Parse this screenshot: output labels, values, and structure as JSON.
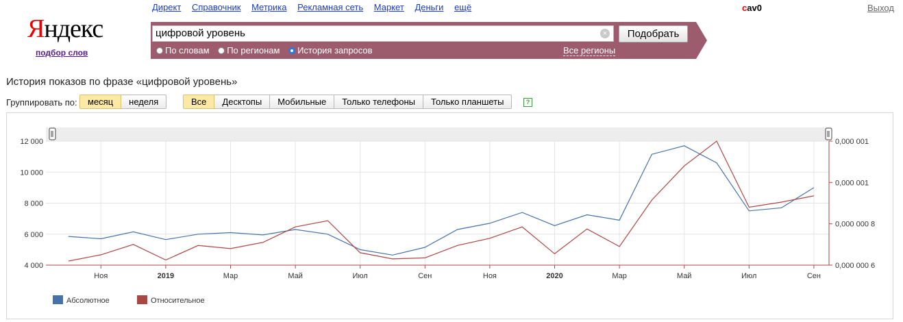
{
  "nav": {
    "links": [
      "Директ",
      "Справочник",
      "Метрика",
      "Рекламная сеть",
      "Маркет",
      "Деньги",
      "ещё"
    ],
    "user_first": "c",
    "user_rest": "av0",
    "logout": "Выход"
  },
  "logo": {
    "first": "Я",
    "rest": "ндекс",
    "sub": "подбор слов"
  },
  "search": {
    "query": "цифровой уровень",
    "clear_icon": "×",
    "submit_label": "Подобрать",
    "modes": [
      {
        "label": "По словам",
        "selected": false
      },
      {
        "label": "По регионам",
        "selected": false
      },
      {
        "label": "История запросов",
        "selected": true
      }
    ],
    "regions_link": "Все регионы"
  },
  "page": {
    "heading": "История показов по фразе «цифровой уровень»",
    "group_label": "Группировать по:",
    "period_buttons": [
      {
        "label": "месяц",
        "active": true
      },
      {
        "label": "неделя",
        "active": false
      }
    ],
    "device_buttons": [
      {
        "label": "Все",
        "active": true
      },
      {
        "label": "Десктопы",
        "active": false
      },
      {
        "label": "Мобильные",
        "active": false
      },
      {
        "label": "Только телефоны",
        "active": false
      },
      {
        "label": "Только планшеты",
        "active": false
      }
    ],
    "help_label": "?"
  },
  "chart_data": {
    "type": "line",
    "x": [
      "2018-10",
      "2018-11",
      "2018-12",
      "2019-01",
      "2019-02",
      "2019-03",
      "2019-04",
      "2019-05",
      "2019-06",
      "2019-07",
      "2019-08",
      "2019-09",
      "2019-10",
      "2019-11",
      "2019-12",
      "2020-01",
      "2020-02",
      "2020-03",
      "2020-04",
      "2020-05",
      "2020-06",
      "2020-07",
      "2020-08",
      "2020-09"
    ],
    "tick_labels": [
      {
        "month": "2018-11",
        "label": "Ноя",
        "bold": false
      },
      {
        "month": "2019-01",
        "label": "2019",
        "bold": true
      },
      {
        "month": "2019-03",
        "label": "Мар",
        "bold": false
      },
      {
        "month": "2019-05",
        "label": "Май",
        "bold": false
      },
      {
        "month": "2019-07",
        "label": "Июл",
        "bold": false
      },
      {
        "month": "2019-09",
        "label": "Сен",
        "bold": false
      },
      {
        "month": "2019-11",
        "label": "Ноя",
        "bold": false
      },
      {
        "month": "2020-01",
        "label": "2020",
        "bold": true
      },
      {
        "month": "2020-03",
        "label": "Мар",
        "bold": false
      },
      {
        "month": "2020-05",
        "label": "Май",
        "bold": false
      },
      {
        "month": "2020-07",
        "label": "Июл",
        "bold": false
      },
      {
        "month": "2020-09",
        "label": "Сен",
        "bold": false
      }
    ],
    "left_axis": {
      "ylim": [
        4000,
        12000
      ],
      "ticks": [
        "12 000",
        "10 000",
        "8 000",
        "6 000",
        "4 000"
      ]
    },
    "right_axis": {
      "ylim": [
        6e-07,
        1.2e-06
      ],
      "ticks": [
        "0,000 001",
        "0,000 001",
        "0,000 000 8",
        "0,000 000 6"
      ]
    },
    "series": [
      {
        "name": "Абсолютное",
        "axis": "left",
        "color": "#4572a7",
        "values": [
          5850,
          5700,
          6150,
          5650,
          6000,
          6100,
          5950,
          6300,
          6000,
          5000,
          4650,
          5150,
          6300,
          6700,
          7400,
          6550,
          7250,
          6900,
          11150,
          11700,
          10600,
          7500,
          7700,
          9000
        ]
      },
      {
        "name": "Относительное",
        "axis": "right",
        "color": "#aa4643",
        "values": [
          6.2e-07,
          6.5e-07,
          7e-07,
          6.25e-07,
          6.95e-07,
          6.8e-07,
          7.1e-07,
          7.85e-07,
          8.15e-07,
          6.6e-07,
          6.3e-07,
          6.35e-07,
          6.95e-07,
          7.3e-07,
          7.85e-07,
          6.55e-07,
          7.75e-07,
          6.9e-07,
          9.15e-07,
          1.08e-06,
          1.2e-06,
          8.8e-07,
          9.05e-07,
          9.35e-07
        ]
      }
    ],
    "grid": true,
    "legend_position": "bottom-left"
  }
}
